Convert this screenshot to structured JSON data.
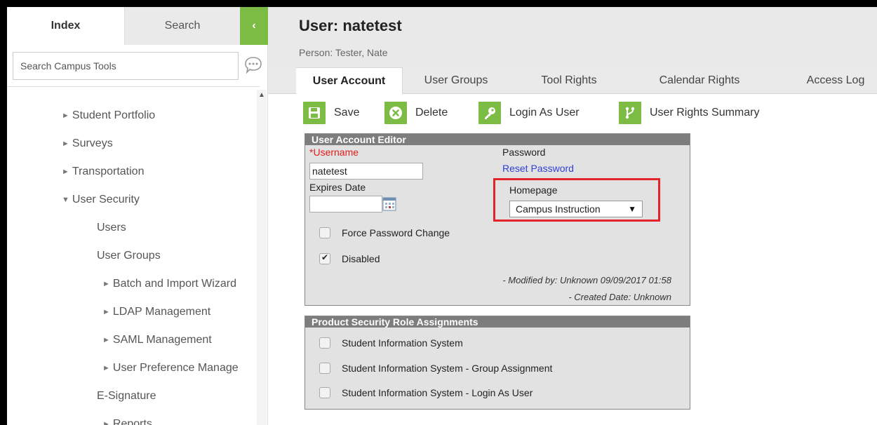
{
  "left_panel": {
    "tabs": {
      "index": "Index",
      "search": "Search"
    },
    "collapse_glyph": "‹",
    "search_placeholder": "Search Campus Tools",
    "tree": [
      {
        "label": "Student Portfolio",
        "arrow": "►"
      },
      {
        "label": "Surveys",
        "arrow": "►"
      },
      {
        "label": "Transportation",
        "arrow": "►"
      },
      {
        "label": "User Security",
        "arrow": "▼"
      },
      {
        "label": "Users",
        "arrow": ""
      },
      {
        "label": "User Groups",
        "arrow": ""
      },
      {
        "label": "Batch and Import Wizard",
        "arrow": "►"
      },
      {
        "label": "LDAP Management",
        "arrow": "►"
      },
      {
        "label": "SAML Management",
        "arrow": "►"
      },
      {
        "label": "User Preference Manage",
        "arrow": "►"
      },
      {
        "label": "E-Signature",
        "arrow": ""
      },
      {
        "label": "Reports",
        "arrow": "►"
      }
    ]
  },
  "header": {
    "title": "User: natetest",
    "subtitle": "Person: Tester, Nate"
  },
  "tabs": [
    "User Account",
    "User Groups",
    "Tool Rights",
    "Calendar Rights",
    "Access Log"
  ],
  "toolbar": {
    "save": "Save",
    "delete": "Delete",
    "login_as": "Login As User",
    "rights_summary": "User Rights Summary"
  },
  "editor": {
    "title": "User Account Editor",
    "username_req": "*",
    "username_label": "Username",
    "username_value": "natetest",
    "expires_label": "Expires Date",
    "password_label": "Password",
    "reset_link": "Reset Password",
    "homepage_label": "Homepage",
    "homepage_value": "Campus Instruction",
    "force_pw": "Force Password Change",
    "disabled": "Disabled",
    "modified": "- Modified by: Unknown 09/09/2017 01:58",
    "created": "- Created Date: Unknown"
  },
  "products": {
    "title": "Product Security Role Assignments",
    "items": [
      "Student Information System",
      "Student Information System - Group Assignment",
      "Student Information System - Login As User"
    ]
  },
  "colors": {
    "accent": "#7cbc44",
    "highlight": "#e4232a",
    "link": "#2f3fd6",
    "required": "#e21b1b"
  }
}
